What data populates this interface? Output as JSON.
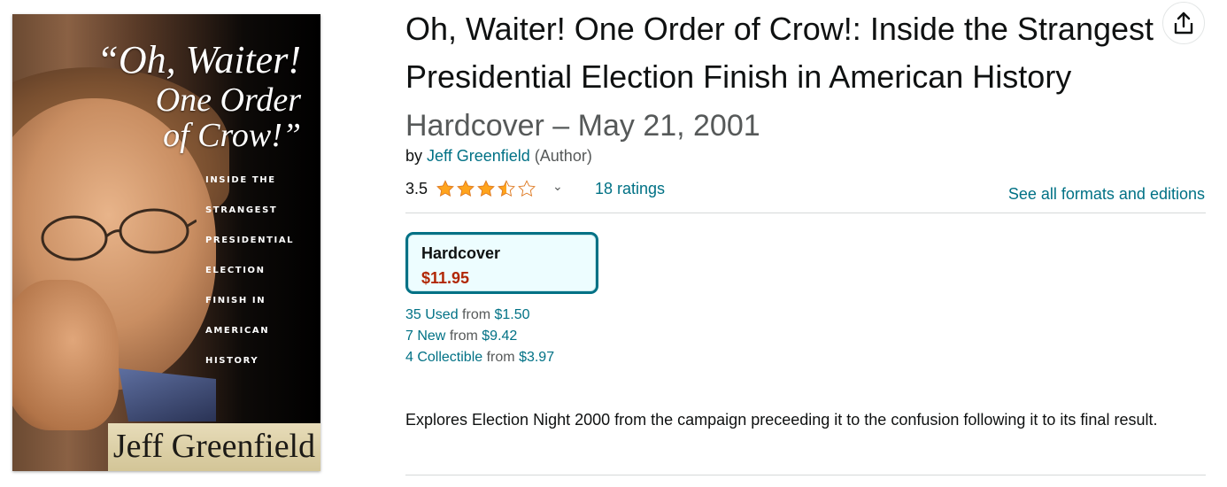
{
  "cover": {
    "title_line1": "“Oh, Waiter!",
    "title_line2": "One Order",
    "title_line3": "of Crow!”",
    "subtitle_lines": [
      "Inside the",
      "Strangest",
      "Presidential",
      "Election",
      "Finish in",
      "American",
      "History"
    ],
    "author": "Jeff Greenfield"
  },
  "product": {
    "title": "Oh, Waiter! One Order of Crow!: Inside the Strangest Presidential Election Finish in American History",
    "format_date": "Hardcover – May 21, 2001",
    "by_prefix": "by",
    "author_name": "Jeff Greenfield",
    "author_role": "(Author)"
  },
  "rating": {
    "value": "3.5",
    "stars": 3.5,
    "count_label": "18 ratings",
    "formats_link": "See all formats and editions"
  },
  "format": {
    "name": "Hardcover",
    "price": "$11.95"
  },
  "offers": [
    {
      "label": "35 Used",
      "from": "from",
      "price": "$1.50"
    },
    {
      "label": "7 New",
      "from": "from",
      "price": "$9.42"
    },
    {
      "label": "4 Collectible",
      "from": "from",
      "price": "$3.97"
    }
  ],
  "description": "Explores Election Night 2000 from the campaign preceeding it to the confusion following it to its final result.",
  "icons": {
    "share": "share-icon",
    "star": "star-icon",
    "chevron": "chevron-down-icon"
  },
  "colors": {
    "link": "#007185",
    "price": "#b12704",
    "star": "#ffa41c",
    "selected_border": "#007185",
    "selected_bg": "#edfdff"
  }
}
